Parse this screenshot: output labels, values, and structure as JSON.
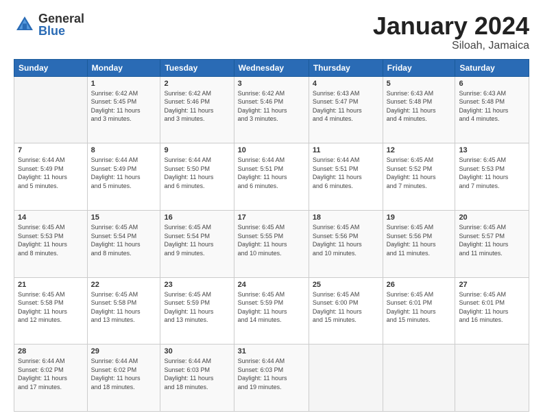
{
  "header": {
    "logo_general": "General",
    "logo_blue": "Blue",
    "title": "January 2024",
    "location": "Siloah, Jamaica"
  },
  "days_of_week": [
    "Sunday",
    "Monday",
    "Tuesday",
    "Wednesday",
    "Thursday",
    "Friday",
    "Saturday"
  ],
  "weeks": [
    [
      {
        "day": "",
        "info": ""
      },
      {
        "day": "1",
        "info": "Sunrise: 6:42 AM\nSunset: 5:45 PM\nDaylight: 11 hours\nand 3 minutes."
      },
      {
        "day": "2",
        "info": "Sunrise: 6:42 AM\nSunset: 5:46 PM\nDaylight: 11 hours\nand 3 minutes."
      },
      {
        "day": "3",
        "info": "Sunrise: 6:42 AM\nSunset: 5:46 PM\nDaylight: 11 hours\nand 3 minutes."
      },
      {
        "day": "4",
        "info": "Sunrise: 6:43 AM\nSunset: 5:47 PM\nDaylight: 11 hours\nand 4 minutes."
      },
      {
        "day": "5",
        "info": "Sunrise: 6:43 AM\nSunset: 5:48 PM\nDaylight: 11 hours\nand 4 minutes."
      },
      {
        "day": "6",
        "info": "Sunrise: 6:43 AM\nSunset: 5:48 PM\nDaylight: 11 hours\nand 4 minutes."
      }
    ],
    [
      {
        "day": "7",
        "info": "Sunrise: 6:44 AM\nSunset: 5:49 PM\nDaylight: 11 hours\nand 5 minutes."
      },
      {
        "day": "8",
        "info": "Sunrise: 6:44 AM\nSunset: 5:49 PM\nDaylight: 11 hours\nand 5 minutes."
      },
      {
        "day": "9",
        "info": "Sunrise: 6:44 AM\nSunset: 5:50 PM\nDaylight: 11 hours\nand 6 minutes."
      },
      {
        "day": "10",
        "info": "Sunrise: 6:44 AM\nSunset: 5:51 PM\nDaylight: 11 hours\nand 6 minutes."
      },
      {
        "day": "11",
        "info": "Sunrise: 6:44 AM\nSunset: 5:51 PM\nDaylight: 11 hours\nand 6 minutes."
      },
      {
        "day": "12",
        "info": "Sunrise: 6:45 AM\nSunset: 5:52 PM\nDaylight: 11 hours\nand 7 minutes."
      },
      {
        "day": "13",
        "info": "Sunrise: 6:45 AM\nSunset: 5:53 PM\nDaylight: 11 hours\nand 7 minutes."
      }
    ],
    [
      {
        "day": "14",
        "info": "Sunrise: 6:45 AM\nSunset: 5:53 PM\nDaylight: 11 hours\nand 8 minutes."
      },
      {
        "day": "15",
        "info": "Sunrise: 6:45 AM\nSunset: 5:54 PM\nDaylight: 11 hours\nand 8 minutes."
      },
      {
        "day": "16",
        "info": "Sunrise: 6:45 AM\nSunset: 5:54 PM\nDaylight: 11 hours\nand 9 minutes."
      },
      {
        "day": "17",
        "info": "Sunrise: 6:45 AM\nSunset: 5:55 PM\nDaylight: 11 hours\nand 10 minutes."
      },
      {
        "day": "18",
        "info": "Sunrise: 6:45 AM\nSunset: 5:56 PM\nDaylight: 11 hours\nand 10 minutes."
      },
      {
        "day": "19",
        "info": "Sunrise: 6:45 AM\nSunset: 5:56 PM\nDaylight: 11 hours\nand 11 minutes."
      },
      {
        "day": "20",
        "info": "Sunrise: 6:45 AM\nSunset: 5:57 PM\nDaylight: 11 hours\nand 11 minutes."
      }
    ],
    [
      {
        "day": "21",
        "info": "Sunrise: 6:45 AM\nSunset: 5:58 PM\nDaylight: 11 hours\nand 12 minutes."
      },
      {
        "day": "22",
        "info": "Sunrise: 6:45 AM\nSunset: 5:58 PM\nDaylight: 11 hours\nand 13 minutes."
      },
      {
        "day": "23",
        "info": "Sunrise: 6:45 AM\nSunset: 5:59 PM\nDaylight: 11 hours\nand 13 minutes."
      },
      {
        "day": "24",
        "info": "Sunrise: 6:45 AM\nSunset: 5:59 PM\nDaylight: 11 hours\nand 14 minutes."
      },
      {
        "day": "25",
        "info": "Sunrise: 6:45 AM\nSunset: 6:00 PM\nDaylight: 11 hours\nand 15 minutes."
      },
      {
        "day": "26",
        "info": "Sunrise: 6:45 AM\nSunset: 6:01 PM\nDaylight: 11 hours\nand 15 minutes."
      },
      {
        "day": "27",
        "info": "Sunrise: 6:45 AM\nSunset: 6:01 PM\nDaylight: 11 hours\nand 16 minutes."
      }
    ],
    [
      {
        "day": "28",
        "info": "Sunrise: 6:44 AM\nSunset: 6:02 PM\nDaylight: 11 hours\nand 17 minutes."
      },
      {
        "day": "29",
        "info": "Sunrise: 6:44 AM\nSunset: 6:02 PM\nDaylight: 11 hours\nand 18 minutes."
      },
      {
        "day": "30",
        "info": "Sunrise: 6:44 AM\nSunset: 6:03 PM\nDaylight: 11 hours\nand 18 minutes."
      },
      {
        "day": "31",
        "info": "Sunrise: 6:44 AM\nSunset: 6:03 PM\nDaylight: 11 hours\nand 19 minutes."
      },
      {
        "day": "",
        "info": ""
      },
      {
        "day": "",
        "info": ""
      },
      {
        "day": "",
        "info": ""
      }
    ]
  ]
}
